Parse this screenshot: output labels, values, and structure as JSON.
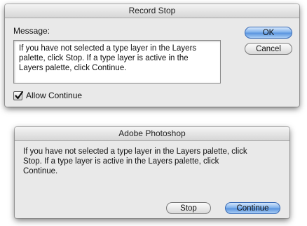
{
  "record_stop": {
    "title": "Record Stop",
    "message_label": "Message:",
    "message_text": "If you have not selected a type layer in the Layers\npalette, click Stop. If a type layer is active in the\nLayers palette, click Continue.",
    "ok_label": "OK",
    "cancel_label": "Cancel",
    "allow_continue_label": "Allow Continue",
    "allow_continue_checked": true
  },
  "photoshop_alert": {
    "title": "Adobe Photoshop",
    "message": "If you have not selected a type layer in the Layers palette, click\nStop. If a type layer is active in the Layers palette, click\nContinue.",
    "stop_label": "Stop",
    "continue_label": "Continue"
  },
  "colors": {
    "default_button": "#5b95df",
    "dialog_background": "#e9e9e9"
  }
}
